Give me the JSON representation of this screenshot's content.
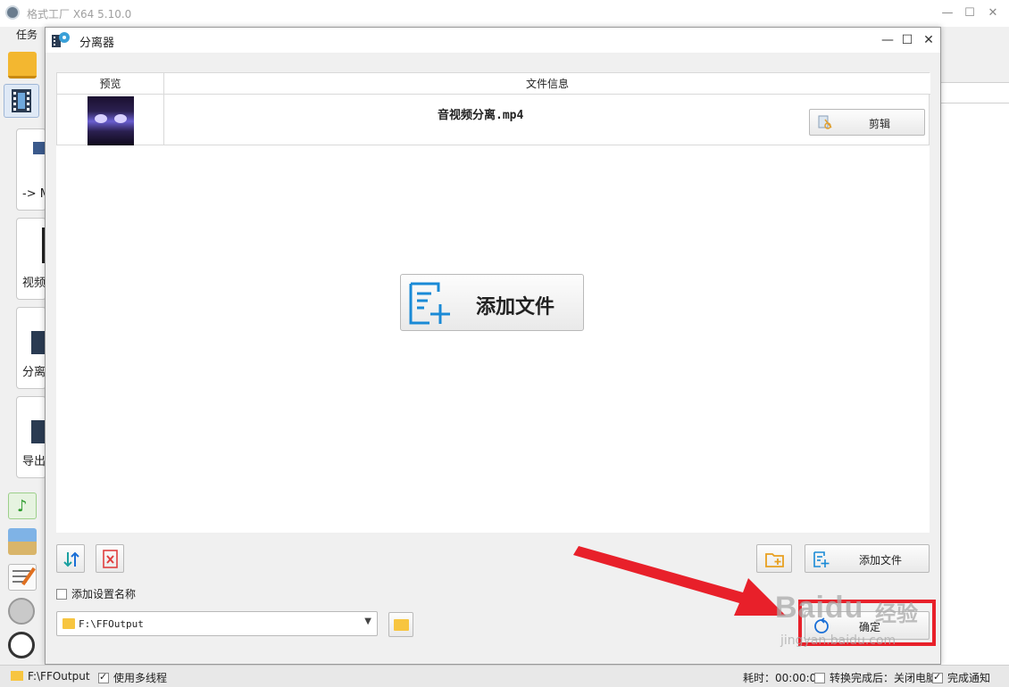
{
  "main_window": {
    "title": "格式工厂 X64 5.10.0",
    "menu": "任务",
    "controls": [
      "—",
      "☐",
      "✕"
    ]
  },
  "left_rail": {
    "cards": [
      {
        "label": "-> M"
      },
      {
        "label": "视频"
      },
      {
        "label": "分离"
      },
      {
        "label": "导出"
      }
    ]
  },
  "dialog": {
    "title": "分离器",
    "controls": [
      "—",
      "☐",
      "✕"
    ],
    "table": {
      "columns": [
        "预览",
        "文件信息"
      ],
      "row": {
        "file_name": "音视频分离.mp4",
        "clip_button": "剪辑"
      }
    },
    "center_add_button": "添加文件",
    "add_file_button": "添加文件",
    "add_setting_name_label": "添加设置名称",
    "output_path": "F:\\FFOutput",
    "ok_button": "确定"
  },
  "statusbar": {
    "path": "F:\\FFOutput",
    "multithread_label": "使用多线程",
    "elapsed": "耗时：00:00:00",
    "after_convert_label": "转换完成后：关闭电脑",
    "notify_label": "完成通知"
  },
  "annotation": {
    "highlight_color": "#e8202a",
    "arrow_color": "#e8202a",
    "watermark_text": "Baidu",
    "watermark_cn": "经验",
    "watermark_small": "jingyan.baidu.com"
  }
}
